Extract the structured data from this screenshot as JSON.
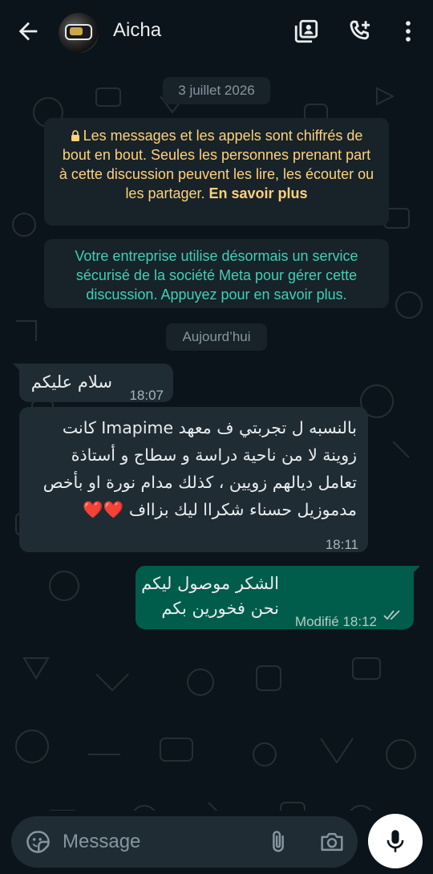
{
  "header": {
    "contact_name": "Aicha",
    "icons": [
      "back-arrow-icon",
      "contacts-icon",
      "add-call-icon",
      "more-vert-icon"
    ]
  },
  "chat": {
    "date_separator": "3 juillet 2026",
    "encryption_notice": {
      "text": "Les messages et les appels sont chiffrés de bout en bout. Seules les personnes prenant part à cette discussion peuvent les lire, les écouter ou les partager.",
      "link": "En savoir plus"
    },
    "business_notice": "Votre entreprise utilise désormais un service sécurisé de la société Meta pour gérer cette discussion. Appuyez pour en savoir plus.",
    "today_separator": "Aujourd’hui",
    "messages": [
      {
        "direction": "incoming",
        "text": "سلام عليكم",
        "time": "18:07"
      },
      {
        "direction": "incoming",
        "text": "بالنسبه ل تجربتي ف معهد Imapime كانت زوينة لا من ناحية دراسة و سطاج و أستاذة تعامل ديالهم زويين ، كذلك مدام نورة او بأخص مدموزيل حسناء شكراا ليك بزااف ❤️❤️",
        "time": "18:11"
      },
      {
        "direction": "outgoing",
        "line1": "الشكر موصول ليكم",
        "line2": "نحن فخورين بكم",
        "status": "Modifié",
        "time": "18:12",
        "read": true
      }
    ]
  },
  "composer": {
    "placeholder": "Message"
  },
  "colors": {
    "background": "#0b141a",
    "incoming_bubble": "#202c33",
    "outgoing_bubble": "#005c4b",
    "encryption_text": "#ffd279",
    "business_text": "#3fd0b6",
    "accent": "#25d366"
  }
}
